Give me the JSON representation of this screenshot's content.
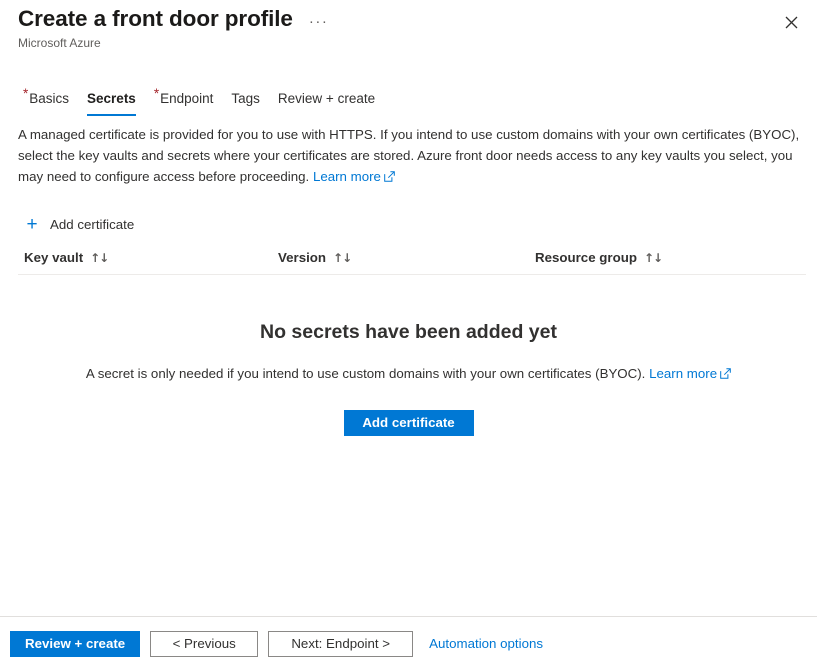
{
  "header": {
    "title": "Create a front door profile",
    "subtitle": "Microsoft Azure",
    "ellipsis": "···",
    "close_label": "✕"
  },
  "tabs": [
    {
      "label": "Basics",
      "required": true,
      "active": false
    },
    {
      "label": "Secrets",
      "required": false,
      "active": true
    },
    {
      "label": "Endpoint",
      "required": true,
      "active": false
    },
    {
      "label": "Tags",
      "required": false,
      "active": false
    },
    {
      "label": "Review + create",
      "required": false,
      "active": false
    }
  ],
  "description": {
    "text": "A managed certificate is provided for you to use with HTTPS. If you intend to use custom domains with your own certificates (BYOC), select the key vaults and secrets where your certificates are stored. Azure front door needs access to any key vaults you select, you may need to configure access before proceeding.",
    "link_label": "Learn more"
  },
  "command_bar": {
    "add_certificate_label": "Add certificate",
    "plus_glyph": "+"
  },
  "table": {
    "columns": [
      {
        "label": "Key vault",
        "sort_glyph": "↑↓"
      },
      {
        "label": "Version",
        "sort_glyph": "↑↓"
      },
      {
        "label": "Resource group",
        "sort_glyph": "↑↓"
      }
    ]
  },
  "empty_state": {
    "title": "No secrets have been added yet",
    "subtitle": "A secret is only needed if you intend to use custom domains with your own certificates (BYOC).",
    "link_label": "Learn more",
    "button_label": "Add certificate"
  },
  "footer": {
    "review_create_label": "Review + create",
    "previous_label": "< Previous",
    "next_label": "Next: Endpoint >",
    "automation_label": "Automation options"
  },
  "colors": {
    "accent": "#0078d4",
    "required_asterisk": "#a4262c",
    "text": "#323130",
    "subtle_text": "#605e5c",
    "divider": "#edebe9"
  }
}
